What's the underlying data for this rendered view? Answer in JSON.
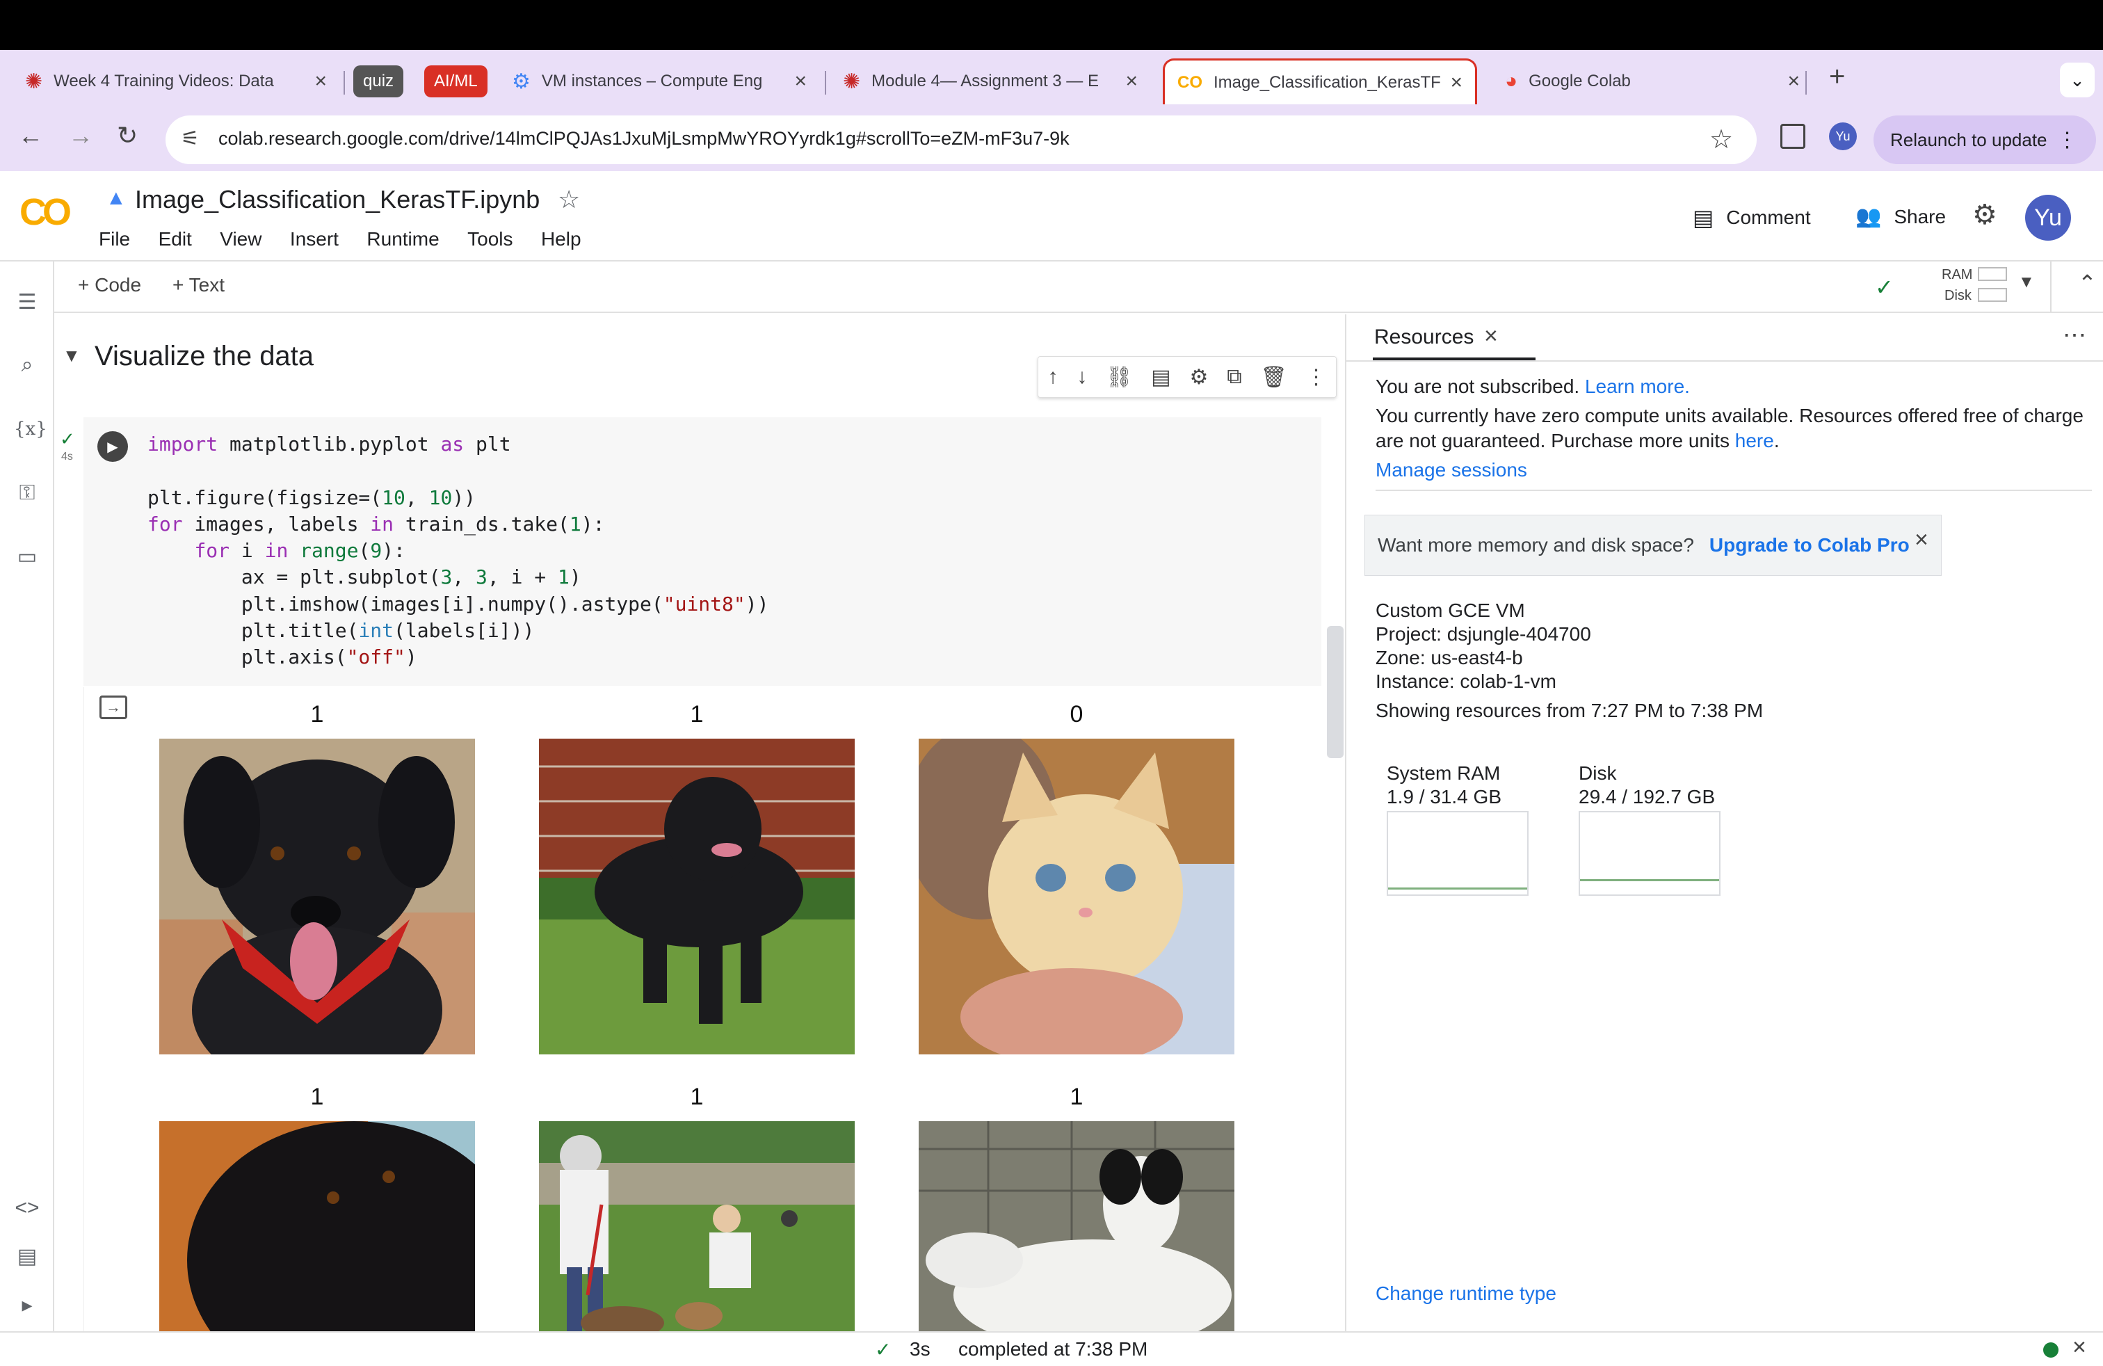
{
  "browser": {
    "tabs": [
      {
        "title": "Week 4 Training Videos: Data",
        "group": null
      },
      {
        "title": "VM instances – Compute Eng",
        "group": null
      },
      {
        "title": "Module 4— Assignment 3 — E",
        "group": null
      },
      {
        "title": "Image_Classification_KerasTF",
        "group": null,
        "active": true
      },
      {
        "title": "Google Colab",
        "group": null
      }
    ],
    "groups": [
      "quiz",
      "AI/ML"
    ],
    "url": "colab.research.google.com/drive/14lmClPQJAs1JxuMjLsmpMwYROYyrdk1g#scrollTo=eZM-mF3u7-9k",
    "profile": "Yu",
    "relaunch_label": "Relaunch to update"
  },
  "colab": {
    "notebook_title": "Image_Classification_KerasTF.ipynb",
    "menu": [
      "File",
      "Edit",
      "View",
      "Insert",
      "Runtime",
      "Tools",
      "Help"
    ],
    "comment_label": "Comment",
    "share_label": "Share",
    "avatar": "Yu",
    "add_code": "+ Code",
    "add_text": "+ Text",
    "ram_label": "RAM",
    "disk_label": "Disk"
  },
  "section_title": "Visualize the data",
  "cell": {
    "exec_time": "4s",
    "code_lines": [
      "import matplotlib.pyplot as plt",
      "",
      "plt.figure(figsize=(10, 10))",
      "for images, labels in train_ds.take(1):",
      "    for i in range(9):",
      "        ax = plt.subplot(3, 3, i + 1)",
      "        plt.imshow(images[i].numpy().astype(\"uint8\"))",
      "        plt.title(int(labels[i]))",
      "        plt.axis(\"off\")"
    ]
  },
  "output_images": [
    {
      "label": "1",
      "subject": "dog-black-red-bandana"
    },
    {
      "label": "1",
      "subject": "dog-black-on-grass"
    },
    {
      "label": "0",
      "subject": "cat-orange-kitten"
    },
    {
      "label": "1",
      "subject": "dog-black-closeup"
    },
    {
      "label": "1",
      "subject": "people-with-dogs-yard"
    },
    {
      "label": "1",
      "subject": "dog-black-white"
    }
  ],
  "resources": {
    "title": "Resources",
    "not_subscribed": "You are not subscribed.",
    "learn_more": "Learn more.",
    "compute_units": "You currently have zero compute units available. Resources offered free of charge are not guaranteed. Purchase more units",
    "here": "here",
    "manage_sessions": "Manage sessions",
    "promo_text": "Want more memory and disk space?",
    "upgrade": "Upgrade to Colab Pro",
    "vm_type": "Custom GCE VM",
    "project": "Project: dsjungle-404700",
    "zone": "Zone: us-east4-b",
    "instance": "Instance: colab-1-vm",
    "showing": "Showing resources from 7:27 PM to 7:38 PM",
    "ram_title": "System RAM",
    "ram_value": "1.9 / 31.4 GB",
    "disk_title": "Disk",
    "disk_value": "29.4 / 192.7 GB",
    "change_runtime": "Change runtime type"
  },
  "status": {
    "time": "3s",
    "completed": "completed at 7:38 PM"
  }
}
